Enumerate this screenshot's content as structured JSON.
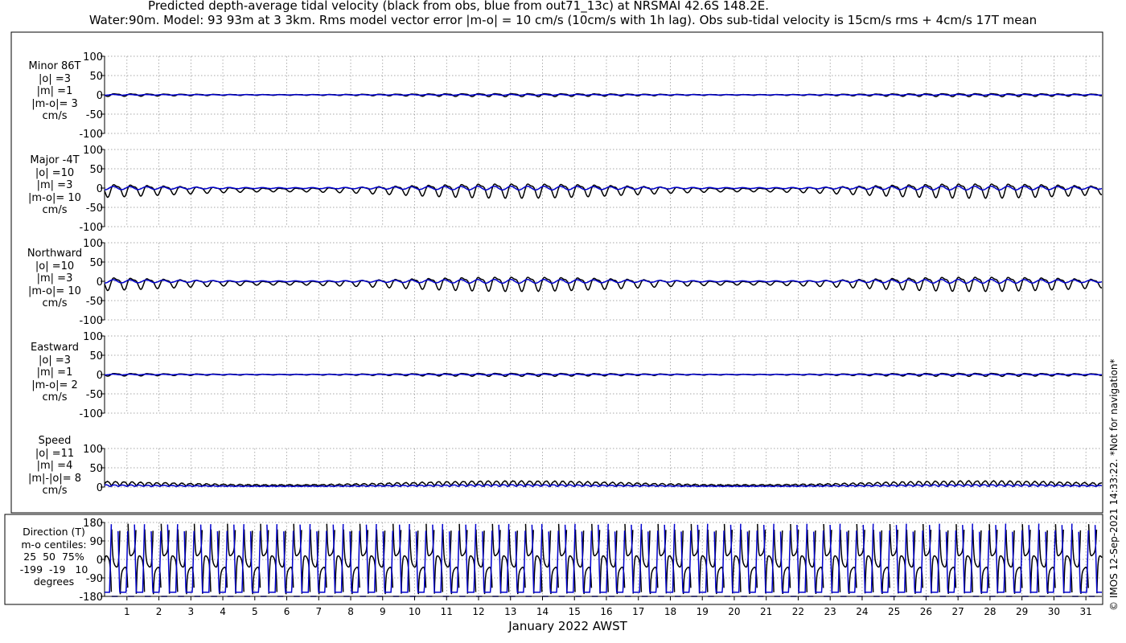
{
  "title_line1": "Predicted depth-average tidal velocity (black from obs, blue from out71_13c) at NRSMAI 42.6S 148.2E.",
  "title_line2": "Water:90m. Model: 93 93m at 3 3km. Rms model vector error |m-o| = 10 cm/s (10cm/s with 1h lag). Obs sub-tidal velocity is 15cm/s rms + 4cm/s 17T mean",
  "xlabel": "January 2022 AWST",
  "copyright": "© IMOS 12-Sep-2021 14:33:22. *Not for navigation*",
  "colors": {
    "obs": "#000000",
    "model": "#0000cc",
    "grid": "#8a8a8a"
  },
  "chart_data": [
    {
      "type": "line",
      "panel_label": "Minor 86T\n|o| =3\n|m| =1\n|m-o|= 3\ncm/s",
      "ylim": [
        -100,
        100
      ],
      "yticks": [
        "100",
        "50",
        "0",
        "-50",
        "-100"
      ],
      "obs_amp": 3,
      "model_amp": 1,
      "series": [
        {
          "name": "obs"
        },
        {
          "name": "model"
        }
      ]
    },
    {
      "type": "line",
      "panel_label": "Major -4T\n|o| =10\n|m| =3\n|m-o|= 10\ncm/s",
      "ylim": [
        -100,
        100
      ],
      "yticks": [
        "100",
        "50",
        "0",
        "-50",
        "-100"
      ],
      "obs_amp": 14,
      "model_amp": 4,
      "series": [
        {
          "name": "obs"
        },
        {
          "name": "model"
        }
      ]
    },
    {
      "type": "line",
      "panel_label": "Northward\n|o| =10\n|m| =3\n|m-o|= 10\ncm/s",
      "ylim": [
        -100,
        100
      ],
      "yticks": [
        "100",
        "50",
        "0",
        "-50",
        "-100"
      ],
      "obs_amp": 14,
      "model_amp": 4,
      "series": [
        {
          "name": "obs"
        },
        {
          "name": "model"
        }
      ]
    },
    {
      "type": "line",
      "panel_label": "Eastward\n|o| =3\n|m| =1\n|m-o|= 2\ncm/s",
      "ylim": [
        -100,
        100
      ],
      "yticks": [
        "100",
        "50",
        "0",
        "-50",
        "-100"
      ],
      "obs_amp": 3,
      "model_amp": 1,
      "series": [
        {
          "name": "obs"
        },
        {
          "name": "model"
        }
      ]
    },
    {
      "type": "line",
      "panel_label": "Speed\n|o| =11\n|m| =4\n|m|-|o|= 8\ncm/s",
      "ylim": [
        0,
        100
      ],
      "yticks": [
        "100",
        "50",
        "0"
      ],
      "obs_amp": 11,
      "model_amp": 4,
      "series": [
        {
          "name": "obs"
        },
        {
          "name": "model"
        }
      ]
    },
    {
      "type": "line",
      "panel_label": "Direction (T)\nm-o centiles:\n25  50  75%\n-199  -19   10\ndegrees",
      "ylim": [
        -180,
        180
      ],
      "yticks": [
        "180",
        "90",
        "0",
        "-90",
        "-180"
      ],
      "series": [
        {
          "name": "obs"
        },
        {
          "name": "model"
        }
      ]
    }
  ],
  "x_axis": {
    "xlim": [
      0.3,
      31.5
    ],
    "ticks": [
      1,
      2,
      3,
      4,
      5,
      6,
      7,
      8,
      9,
      10,
      11,
      12,
      13,
      14,
      15,
      16,
      17,
      18,
      19,
      20,
      21,
      22,
      23,
      24,
      25,
      26,
      27,
      28,
      29,
      30,
      31
    ]
  }
}
